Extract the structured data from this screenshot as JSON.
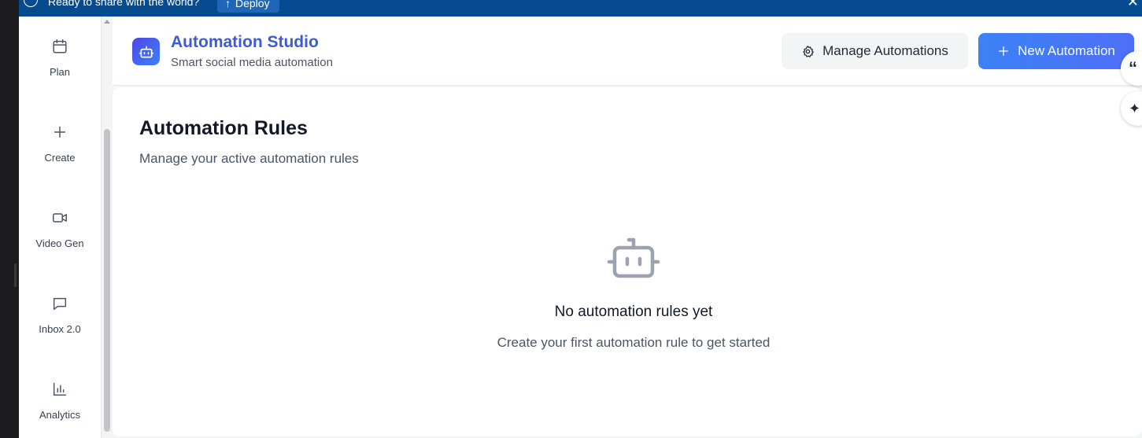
{
  "banner": {
    "text": "Ready to share with the world?",
    "deploy_label": "Deploy"
  },
  "sidebar": {
    "items": [
      {
        "label": "Plan",
        "icon": "calendar-icon"
      },
      {
        "label": "Create",
        "icon": "plus-icon"
      },
      {
        "label": "Video Gen",
        "icon": "video-icon"
      },
      {
        "label": "Inbox 2.0",
        "icon": "message-icon"
      },
      {
        "label": "Analytics",
        "icon": "bar-chart-icon"
      }
    ]
  },
  "header": {
    "title": "Automation Studio",
    "subtitle": "Smart social media automation",
    "manage_label": "Manage Automations",
    "new_label": "New Automation"
  },
  "rules": {
    "title": "Automation Rules",
    "subtitle": "Manage your active automation rules",
    "empty_title": "No automation rules yet",
    "empty_subtitle": "Create your first automation rule to get started"
  },
  "colors": {
    "banner": "#064b8f",
    "brand_title": "#3b5bdb",
    "primary_button": "#3b82f6",
    "empty_icon": "#9ca3af"
  }
}
